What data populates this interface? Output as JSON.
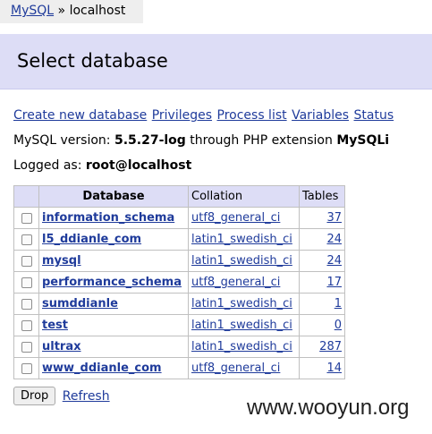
{
  "breadcrumb": {
    "link": "MySQL",
    "separator": "»",
    "current": "localhost"
  },
  "heading": "Select database",
  "links": [
    "Create new database",
    "Privileges",
    "Process list",
    "Variables",
    "Status"
  ],
  "version": {
    "label": "MySQL version:",
    "version": "5.5.27-log",
    "through": "through PHP extension",
    "extension": "MySQLi"
  },
  "logged": {
    "label": "Logged as:",
    "user": "root@localhost"
  },
  "table": {
    "headers": {
      "database": "Database",
      "collation": "Collation",
      "tables": "Tables"
    },
    "rows": [
      {
        "name": "information_schema",
        "collation": "utf8_general_ci",
        "tables": "37"
      },
      {
        "name": "l5_ddianle_com",
        "collation": "latin1_swedish_ci",
        "tables": "24"
      },
      {
        "name": "mysql",
        "collation": "latin1_swedish_ci",
        "tables": "24"
      },
      {
        "name": "performance_schema",
        "collation": "utf8_general_ci",
        "tables": "17"
      },
      {
        "name": "sumddianle",
        "collation": "latin1_swedish_ci",
        "tables": "1"
      },
      {
        "name": "test",
        "collation": "latin1_swedish_ci",
        "tables": "0"
      },
      {
        "name": "ultrax",
        "collation": "latin1_swedish_ci",
        "tables": "287"
      },
      {
        "name": "www_ddianle_com",
        "collation": "utf8_general_ci",
        "tables": "14"
      }
    ]
  },
  "actions": {
    "drop": "Drop",
    "refresh": "Refresh"
  },
  "watermark": "www.wooyun.org",
  "colors": {
    "link": "#1f3b9b",
    "header_bg": "#ddddf6",
    "breadcrumb_bg": "#eeeeee"
  }
}
